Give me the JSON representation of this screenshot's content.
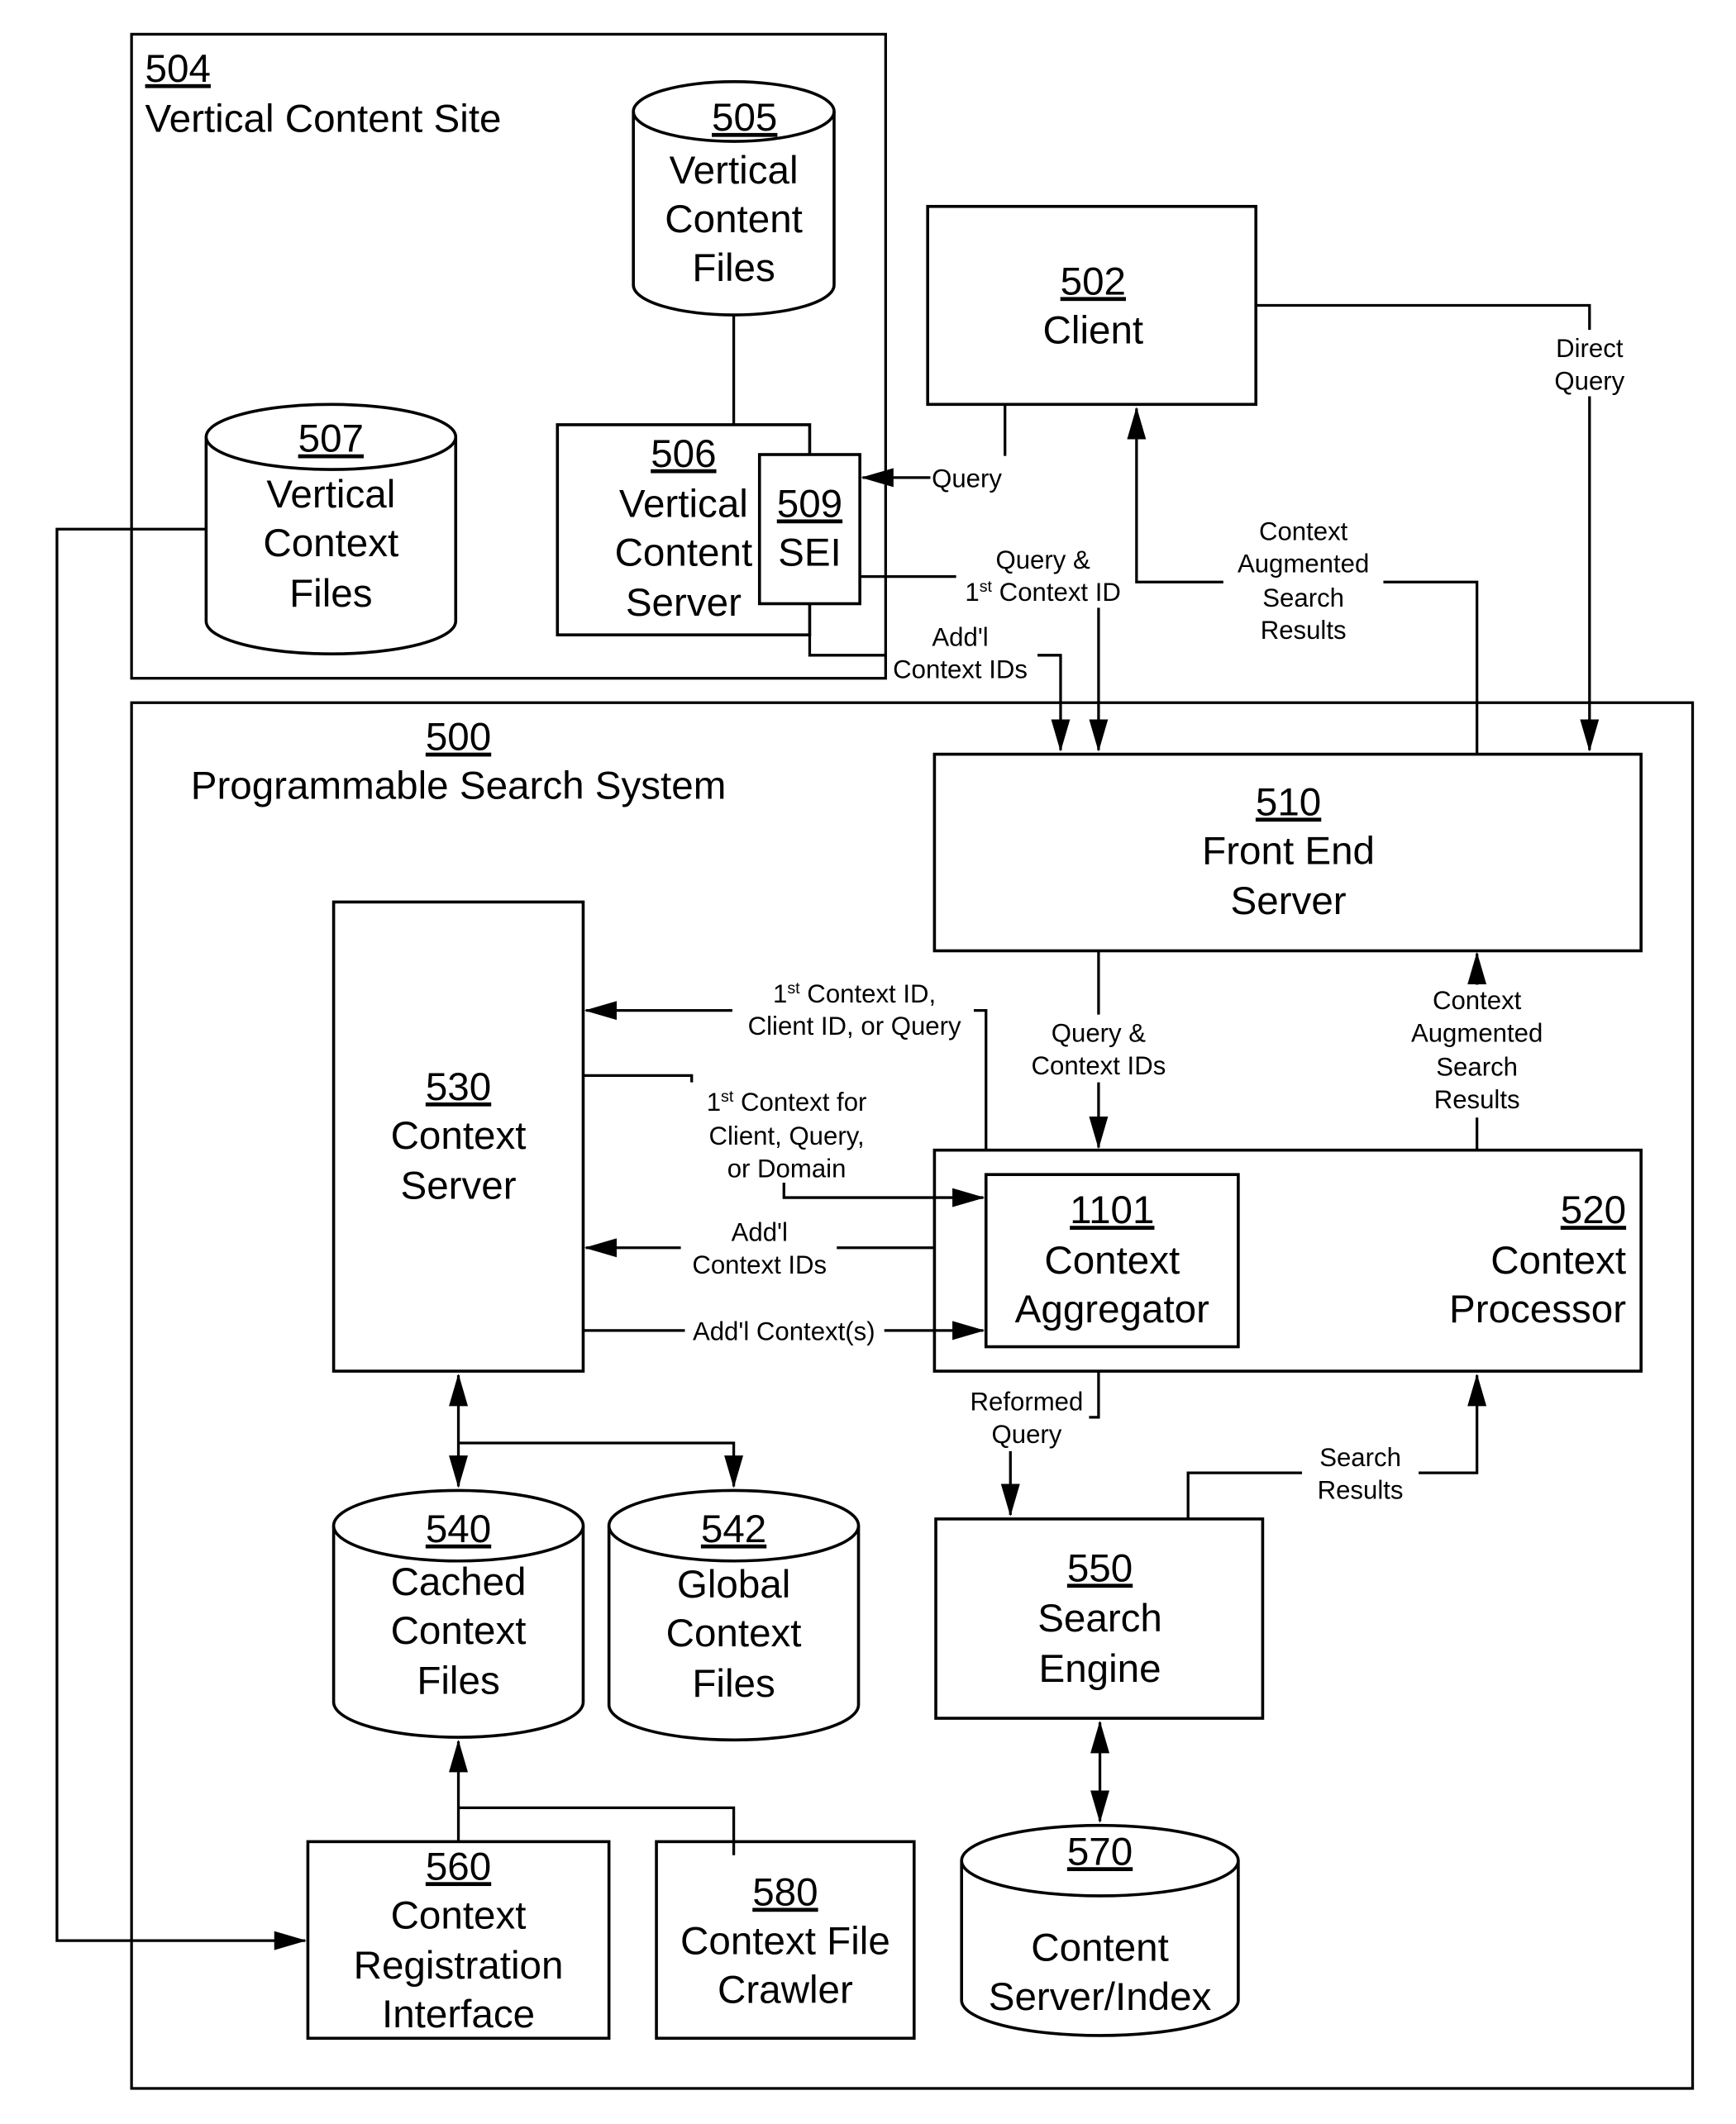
{
  "diagram": {
    "site": {
      "number": "504",
      "title": "Vertical Content Site"
    },
    "system": {
      "number": "500",
      "title": "Programmable Search System"
    },
    "nodes": {
      "vertical_content_files": {
        "number": "505",
        "lines": [
          "Vertical",
          "Content",
          "Files"
        ]
      },
      "vertical_context_files": {
        "number": "507",
        "lines": [
          "Vertical",
          "Context",
          "Files"
        ]
      },
      "vertical_content_server": {
        "number": "506",
        "lines": [
          "Vertical",
          "Content",
          "Server"
        ]
      },
      "sei": {
        "number": "509",
        "lines": [
          "SEI"
        ]
      },
      "client": {
        "number": "502",
        "lines": [
          "Client"
        ]
      },
      "front_end_server": {
        "number": "510",
        "lines": [
          "Front End",
          "Server"
        ]
      },
      "context_server": {
        "number": "530",
        "lines": [
          "Context",
          "Server"
        ]
      },
      "context_processor": {
        "number": "520",
        "lines": [
          "Context",
          "Processor"
        ]
      },
      "context_aggregator": {
        "number": "1101",
        "lines": [
          "Context",
          "Aggregator"
        ]
      },
      "cached_context_files": {
        "number": "540",
        "lines": [
          "Cached",
          "Context",
          "Files"
        ]
      },
      "global_context_files": {
        "number": "542",
        "lines": [
          "Global",
          "Context",
          "Files"
        ]
      },
      "search_engine": {
        "number": "550",
        "lines": [
          "Search",
          "Engine"
        ]
      },
      "context_registration_interface": {
        "number": "560",
        "lines": [
          "Context",
          "Registration",
          "Interface"
        ]
      },
      "context_file_crawler": {
        "number": "580",
        "lines": [
          "Context File",
          "Crawler"
        ]
      },
      "content_server_index": {
        "number": "570",
        "lines": [
          "Content",
          "Server/Index"
        ]
      }
    },
    "edge_labels": {
      "query": "Query",
      "direct_query": [
        "Direct",
        "Query"
      ],
      "query_first_context_id": [
        "Query &",
        "1",
        "st",
        " Context ID"
      ],
      "addl_context_ids_top": [
        "Add'l",
        "Context IDs"
      ],
      "context_augmented_results_top": [
        "Context",
        "Augmented",
        "Search",
        "Results"
      ],
      "first_context_id_client_query": [
        "1",
        "st",
        " Context ID,",
        "Client ID, or Query"
      ],
      "first_context_for": [
        "1",
        "st",
        " Context for",
        "Client, Query,",
        "or Domain"
      ],
      "addl_context_ids_mid": [
        "Add'l",
        "Context IDs"
      ],
      "addl_contexts": "Add'l Context(s)",
      "query_context_ids": [
        "Query &",
        "Context IDs"
      ],
      "context_augmented_results_mid": [
        "Context",
        "Augmented",
        "Search",
        "Results"
      ],
      "reformed_query": [
        "Reformed",
        "Query"
      ],
      "search_results": [
        "Search",
        "Results"
      ]
    }
  }
}
